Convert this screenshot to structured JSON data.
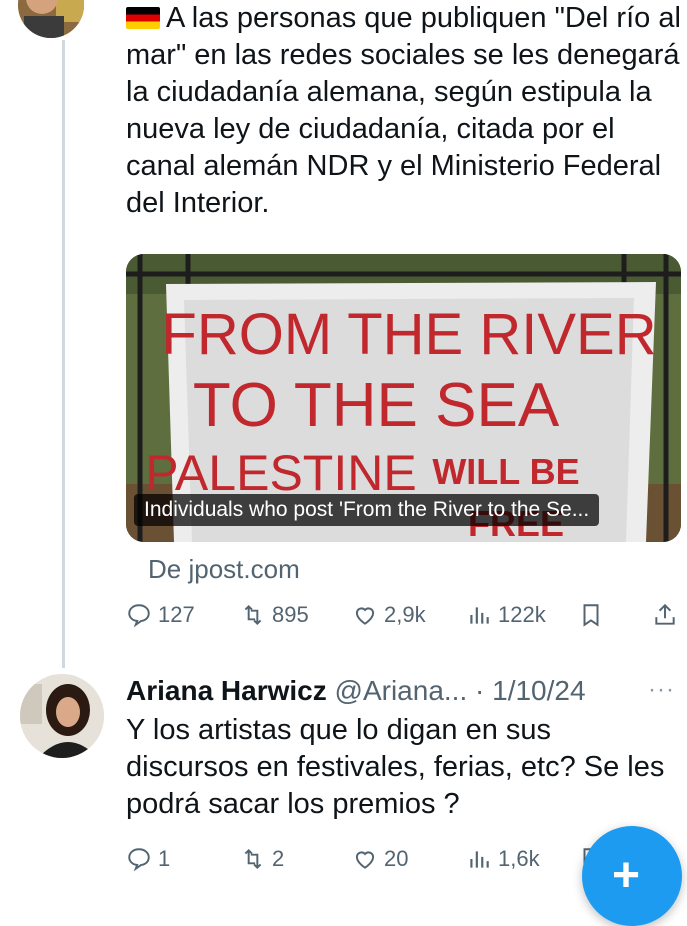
{
  "tweet1": {
    "text": "A las personas que publiquen \"Del río al mar\" en las redes sociales se les denegará la ciudadanía alemana, según estipula la nueva ley de ciudadanía, citada por el canal alemán NDR y el Ministerio Federal del Interior.",
    "flag_icon": "germany-flag-icon",
    "card": {
      "banner_line1": "FROM THE RIVER",
      "banner_line2": "TO THE SEA",
      "banner_line3": "PALESTINE",
      "banner_line4": "WILL BE",
      "banner_line5": "FREE",
      "caption": "Individuals who post 'From the River to the Se...",
      "source": "De jpost.com"
    },
    "actions": {
      "replies": "127",
      "reposts": "895",
      "likes": "2,9k",
      "views": "122k"
    }
  },
  "tweet2": {
    "name": "Ariana Harwicz",
    "handle": "@Ariana...",
    "separator": "·",
    "date": "1/10/24",
    "more": "···",
    "text": "Y los artistas que lo digan en sus discursos en festivales, ferias, etc? Se les podrá sacar los premios ?",
    "actions": {
      "replies": "1",
      "reposts": "2",
      "likes": "20",
      "views": "1,6k"
    }
  },
  "fab": {
    "label": "+"
  },
  "colors": {
    "accent": "#1d9bf0",
    "muted": "#536471",
    "banner_text": "#c0282d"
  }
}
